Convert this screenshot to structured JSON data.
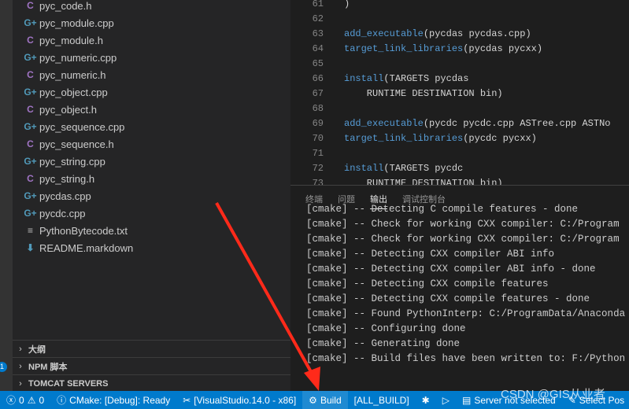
{
  "activity_bar": {
    "badge": "1"
  },
  "explorer": {
    "files": [
      {
        "name": "pyc_code.h",
        "type": "h",
        "icon": "C"
      },
      {
        "name": "pyc_module.cpp",
        "type": "cpp",
        "icon": "G+"
      },
      {
        "name": "pyc_module.h",
        "type": "h",
        "icon": "C"
      },
      {
        "name": "pyc_numeric.cpp",
        "type": "cpp",
        "icon": "G+"
      },
      {
        "name": "pyc_numeric.h",
        "type": "h",
        "icon": "C"
      },
      {
        "name": "pyc_object.cpp",
        "type": "cpp",
        "icon": "G+"
      },
      {
        "name": "pyc_object.h",
        "type": "h",
        "icon": "C"
      },
      {
        "name": "pyc_sequence.cpp",
        "type": "cpp",
        "icon": "G+"
      },
      {
        "name": "pyc_sequence.h",
        "type": "h",
        "icon": "C"
      },
      {
        "name": "pyc_string.cpp",
        "type": "cpp",
        "icon": "G+"
      },
      {
        "name": "pyc_string.h",
        "type": "h",
        "icon": "C"
      },
      {
        "name": "pycdas.cpp",
        "type": "cpp",
        "icon": "G+"
      },
      {
        "name": "pycdc.cpp",
        "type": "cpp",
        "icon": "G+"
      },
      {
        "name": "PythonBytecode.txt",
        "type": "txt",
        "icon": "≡"
      },
      {
        "name": "README.markdown",
        "type": "md",
        "icon": "⬇"
      }
    ],
    "sections": [
      "大纲",
      "NPM 脚本",
      "TOMCAT SERVERS"
    ]
  },
  "editor": {
    "lines": [
      {
        "n": "61",
        "fn": "",
        "rest": ")"
      },
      {
        "n": "62",
        "fn": "",
        "rest": ""
      },
      {
        "n": "63",
        "fn": "add_executable",
        "rest": "(pycdas pycdas.cpp)"
      },
      {
        "n": "64",
        "fn": "target_link_libraries",
        "rest": "(pycdas pycxx)"
      },
      {
        "n": "65",
        "fn": "",
        "rest": ""
      },
      {
        "n": "66",
        "fn": "install",
        "rest": "(TARGETS pycdas"
      },
      {
        "n": "67",
        "fn": "",
        "rest": "    RUNTIME DESTINATION bin)"
      },
      {
        "n": "68",
        "fn": "",
        "rest": ""
      },
      {
        "n": "69",
        "fn": "add_executable",
        "rest": "(pycdc pycdc.cpp ASTree.cpp ASTNo"
      },
      {
        "n": "70",
        "fn": "target_link_libraries",
        "rest": "(pycdc pycxx)"
      },
      {
        "n": "71",
        "fn": "",
        "rest": ""
      },
      {
        "n": "72",
        "fn": "install",
        "rest": "(TARGETS pycdc"
      },
      {
        "n": "73",
        "fn": "",
        "rest": "    RUNTIME DESTINATION bin)"
      }
    ]
  },
  "panel": {
    "tabs": [
      "终端",
      "问题",
      "输出",
      "调试控制台"
    ],
    "active_tab": "输出",
    "output": [
      "[cmake] -- Detecting C compile features - done",
      "[cmake] -- Check for working CXX compiler: C:/Program",
      "[cmake] -- Check for working CXX compiler: C:/Program",
      "[cmake] -- Detecting CXX compiler ABI info",
      "[cmake] -- Detecting CXX compiler ABI info - done",
      "[cmake] -- Detecting CXX compile features",
      "[cmake] -- Detecting CXX compile features - done",
      "[cmake] -- Found PythonInterp: C:/ProgramData/Anaconda",
      "[cmake] -- Configuring done",
      "[cmake] -- Generating done",
      "[cmake] -- Build files have been written to: F:/Python"
    ]
  },
  "status": {
    "errors": "0",
    "warnings": "0",
    "cmake": "CMake: [Debug]: Ready",
    "kit": "[VisualStudio.14.0 - x86]",
    "build": "Build",
    "target": "[ALL_BUILD]",
    "server": "Server not selected",
    "select": "Select Pos"
  },
  "watermark": "CSDN @GIS从业者",
  "colors": {
    "statusbar": "#007acc",
    "annotation_arrow": "#ff2a1a"
  }
}
